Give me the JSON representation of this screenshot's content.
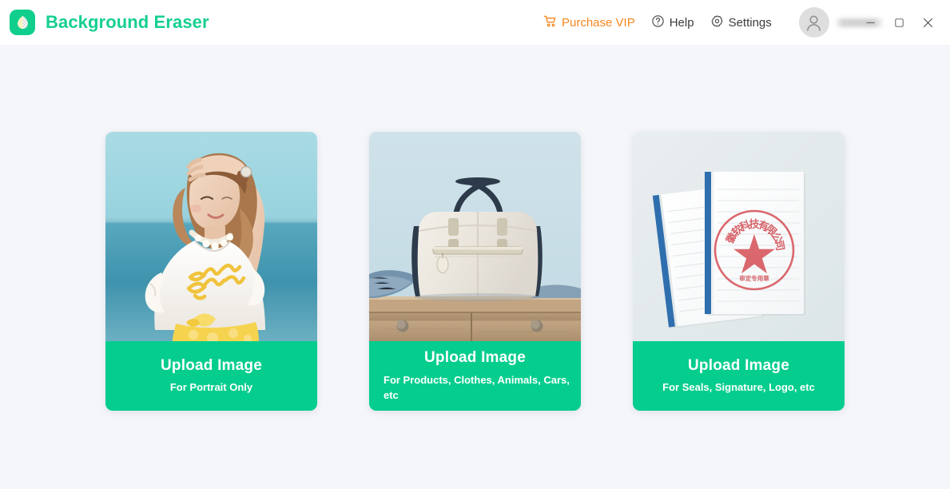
{
  "app": {
    "title": "Background Eraser",
    "logo_icon": "leaf-transparency-logo",
    "brand_color": "#16cf90"
  },
  "header": {
    "purchase_vip": {
      "label": "Purchase VIP",
      "icon": "shopping-cart-icon",
      "color": "#f5871f"
    },
    "help": {
      "label": "Help",
      "icon": "question-circle-icon"
    },
    "settings": {
      "label": "Settings",
      "icon": "gear-icon"
    },
    "account": {
      "username": "",
      "avatar_icon": "user-avatar-icon"
    },
    "window_controls": {
      "minimize": "minimize-icon",
      "maximize": "maximize-icon",
      "close": "close-icon"
    }
  },
  "main": {
    "cards": [
      {
        "id": "portrait",
        "cta_title": "Upload Image",
        "cta_subtitle": "For Portrait Only",
        "thumbnail": "woman-at-beach-portrait-photo"
      },
      {
        "id": "product",
        "cta_title": "Upload Image",
        "cta_subtitle": "For Products, Clothes, Animals, Cars, etc",
        "thumbnail": "white-handbag-on-dresser-photo"
      },
      {
        "id": "seal",
        "cta_title": "Upload Image",
        "cta_subtitle": "For Seals, Signature, Logo, etc",
        "thumbnail": "stacked-documents-with-red-seal-photo"
      }
    ]
  },
  "colors": {
    "accent_green": "#05cd8e",
    "page_background": "#f5f6fa",
    "header_background": "#ffffff"
  }
}
